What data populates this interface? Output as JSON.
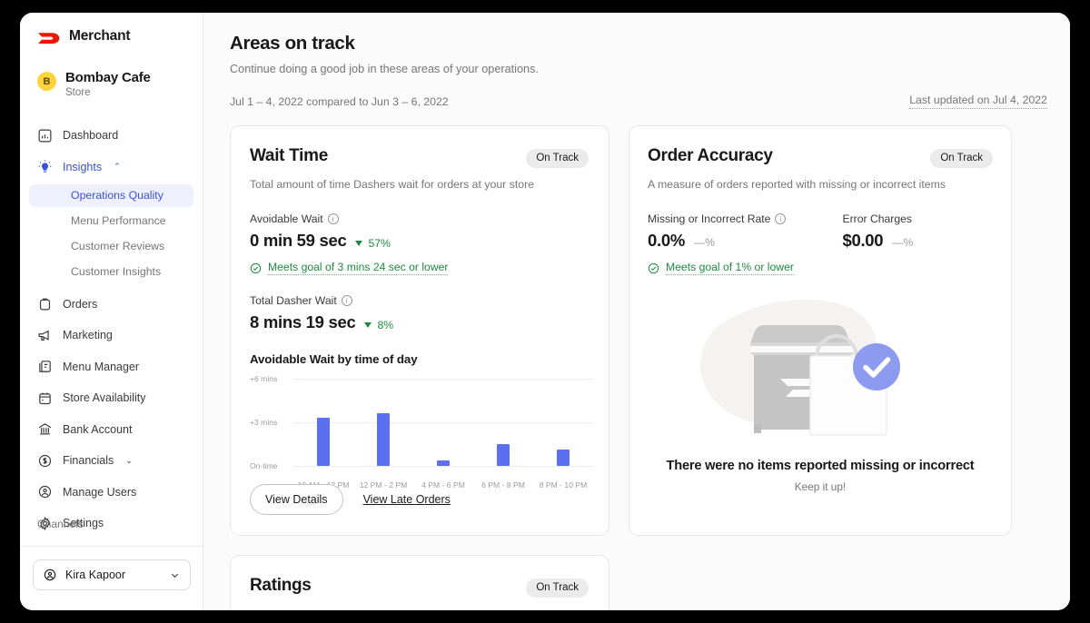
{
  "sidebar": {
    "brand": "Merchant",
    "store": {
      "initial": "B",
      "name": "Bombay Cafe",
      "type": "Store"
    },
    "nav": [
      {
        "label": "Dashboard",
        "icon": "chart-bar-icon"
      },
      {
        "label": "Insights",
        "icon": "lightbulb-icon",
        "caret": "⌃"
      }
    ],
    "subnav": [
      {
        "label": "Operations Quality"
      },
      {
        "label": "Menu Performance"
      },
      {
        "label": "Customer Reviews"
      },
      {
        "label": "Customer Insights"
      }
    ],
    "nav2": [
      {
        "label": "Orders",
        "icon": "bag-icon"
      },
      {
        "label": "Marketing",
        "icon": "megaphone-icon"
      },
      {
        "label": "Menu Manager",
        "icon": "menu-book-icon"
      },
      {
        "label": "Store Availability",
        "icon": "calendar-icon"
      },
      {
        "label": "Bank Account",
        "icon": "bank-icon"
      },
      {
        "label": "Financials",
        "icon": "dollar-circle-icon",
        "caret": "⌄"
      },
      {
        "label": "Manage Users",
        "icon": "user-circle-icon"
      },
      {
        "label": "Settings",
        "icon": "gear-icon"
      }
    ],
    "channels_label": "Channels",
    "user": {
      "name": "Kira Kapoor"
    }
  },
  "header": {
    "title": "Areas on track",
    "subtitle": "Continue doing a good job in these areas of your operations.",
    "compare": "Jul 1 – 4, 2022 compared to Jun 3 – 6, 2022",
    "last_updated": "Last updated on Jul 4, 2022"
  },
  "wait_time": {
    "title": "Wait Time",
    "badge": "On Track",
    "description": "Total amount of time Dashers wait for orders at your store",
    "avoidable": {
      "label": "Avoidable Wait",
      "value": "0 min 59 sec",
      "delta": "57%",
      "goal": "Meets goal of 3 mins 24 sec or lower"
    },
    "total": {
      "label": "Total Dasher Wait",
      "value": "8 mins 19 sec",
      "delta": "8%"
    },
    "chart_title": "Avoidable Wait by time of day",
    "view_details": "View Details",
    "view_late_orders": "View Late Orders"
  },
  "order_accuracy": {
    "title": "Order Accuracy",
    "badge": "On Track",
    "description": "A measure of orders reported with missing or incorrect items",
    "rate": {
      "label": "Missing or Incorrect Rate",
      "value": "0.0%",
      "delta": "—%"
    },
    "charges": {
      "label": "Error Charges",
      "value": "$0.00",
      "delta": "—%"
    },
    "goal": "Meets goal of 1% or lower",
    "empty_title": "There were no items reported missing or incorrect",
    "empty_sub": "Keep it up!"
  },
  "ratings": {
    "title": "Ratings",
    "badge": "On Track"
  },
  "colors": {
    "accent_blue": "#3b52d9",
    "bar_blue": "#5c6ff0",
    "success_green": "#1f8a3e",
    "dd_red": "#eb1700",
    "avatar_yellow": "#ffd43b"
  },
  "chart_data": {
    "type": "bar",
    "title": "Avoidable Wait by time of day",
    "categories": [
      "10 AM - 12 PM",
      "12 PM - 2 PM",
      "4 PM - 6 PM",
      "6 PM - 8 PM",
      "8 PM - 10 PM"
    ],
    "values": [
      3.3,
      3.6,
      0.4,
      1.5,
      1.1
    ],
    "ytick_labels": [
      "+6 mins",
      "+3 mins",
      "On-time"
    ],
    "ytick_values": [
      6,
      3,
      0
    ],
    "ylim": [
      0,
      6
    ],
    "xlabel": "",
    "ylabel": "",
    "grid": true,
    "legend": "none"
  }
}
